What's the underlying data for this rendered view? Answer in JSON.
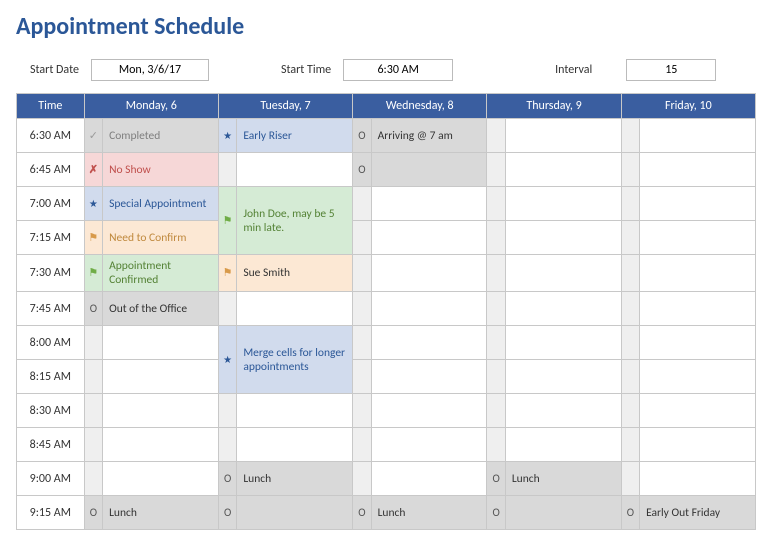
{
  "title": "Appointment Schedule",
  "controls": {
    "start_date_label": "Start Date",
    "start_date_value": "Mon, 3/6/17",
    "start_time_label": "Start Time",
    "start_time_value": "6:30 AM",
    "interval_label": "Interval",
    "interval_value": "15"
  },
  "columns": {
    "time": "Time",
    "mon": "Monday, 6",
    "tue": "Tuesday, 7",
    "wed": "Wednesday, 8",
    "thu": "Thursday, 9",
    "fri": "Friday, 10"
  },
  "rows": [
    {
      "time": "6:30 AM",
      "mon": {
        "icon": "check",
        "text": "Completed",
        "bg": "grey",
        "txt": "grey"
      },
      "tue": {
        "icon": "star",
        "text": "Early Riser",
        "bg": "blue",
        "txt": "blue"
      },
      "wed": {
        "icon": "circle",
        "text": "Arriving @ 7 am",
        "bg": "grey"
      }
    },
    {
      "time": "6:45 AM",
      "mon": {
        "icon": "x",
        "text": "No Show",
        "bg": "red",
        "txt": "red"
      },
      "wed": {
        "icon": "circle",
        "text": "",
        "bg": "grey"
      }
    },
    {
      "time": "7:00 AM",
      "mon": {
        "icon": "star",
        "text": "Special Appointment",
        "bg": "blue",
        "txt": "blue"
      },
      "tue": {
        "icon": "flag-green",
        "text": "John Doe, may be 5 min late.",
        "bg": "green",
        "txt": "green",
        "rowspan": 2
      }
    },
    {
      "time": "7:15 AM",
      "mon": {
        "icon": "flag-orange",
        "text": "Need to Confirm",
        "bg": "orange",
        "txt": "orange"
      }
    },
    {
      "time": "7:30 AM",
      "mon": {
        "icon": "flag-green",
        "text": "Appointment Confirmed",
        "bg": "green",
        "txt": "green"
      },
      "tue": {
        "icon": "flag-orange",
        "text": "Sue Smith",
        "bg": "orange"
      }
    },
    {
      "time": "7:45 AM",
      "mon": {
        "icon": "circle",
        "text": "Out of the Office",
        "bg": "grey"
      }
    },
    {
      "time": "8:00 AM",
      "tue": {
        "icon": "star",
        "text": "Merge cells for longer appointments",
        "bg": "blue",
        "txt": "blue",
        "rowspan": 2,
        "center": true
      }
    },
    {
      "time": "8:15 AM"
    },
    {
      "time": "8:30 AM"
    },
    {
      "time": "8:45 AM"
    },
    {
      "time": "9:00 AM",
      "tue": {
        "icon": "circle",
        "text": "Lunch",
        "bg": "grey"
      },
      "thu": {
        "icon": "circle",
        "text": "Lunch",
        "bg": "grey"
      }
    },
    {
      "time": "9:15 AM",
      "mon": {
        "icon": "circle",
        "text": "Lunch",
        "bg": "grey"
      },
      "tue": {
        "icon": "circle",
        "text": "",
        "bg": "grey"
      },
      "wed": {
        "icon": "circle",
        "text": "Lunch",
        "bg": "grey"
      },
      "thu": {
        "icon": "circle",
        "text": "",
        "bg": "grey"
      },
      "fri": {
        "icon": "circle",
        "text": "Early Out Friday",
        "bg": "grey"
      }
    }
  ]
}
